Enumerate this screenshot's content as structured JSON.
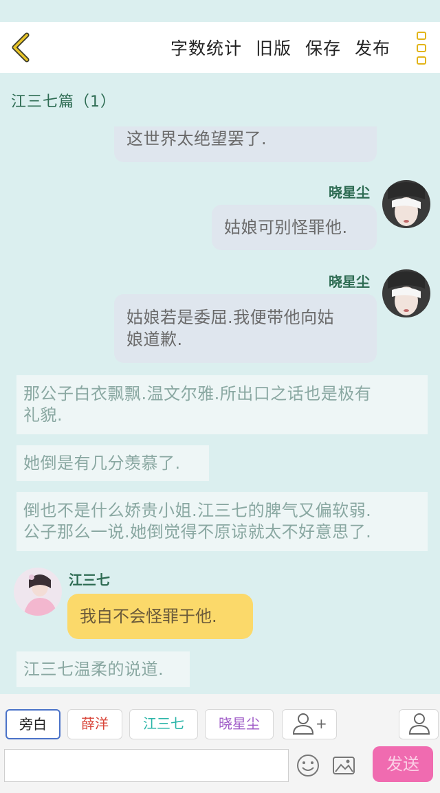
{
  "header": {
    "actions": [
      "字数统计",
      "旧版",
      "保存",
      "发布"
    ]
  },
  "chapter_title": "江三七篇（1）",
  "messages": {
    "partial_bubble": "这世界太绝望罢了.",
    "m1": {
      "speaker": "晓星尘",
      "text": "姑娘可别怪罪他."
    },
    "m2": {
      "speaker": "晓星尘",
      "text_line1": "姑娘若是委屈.我便带他向姑",
      "text_line2": "娘道歉."
    },
    "n1": {
      "line1": "那公子白衣飘飘.温文尔雅.所出口之话也是极有",
      "line2": "礼貌."
    },
    "n2": {
      "line1": "她倒是有几分羡慕了."
    },
    "n3": {
      "line1": "倒也不是什么娇贵小姐.江三七的脾气又偏软弱.",
      "line2": "公子那么一说.她倒觉得不原谅就太不好意思了."
    },
    "m3": {
      "speaker": "江三七",
      "text": "我自不会怪罪于他."
    },
    "n4": {
      "line1": "江三七温柔的说道."
    }
  },
  "roles": [
    {
      "label": "旁白",
      "color": "#222222"
    },
    {
      "label": "薛洋",
      "color": "#d9463a"
    },
    {
      "label": "江三七",
      "color": "#2bb5a8"
    },
    {
      "label": "晓星尘",
      "color": "#a05cc8"
    }
  ],
  "add_role_label": "+",
  "input": {
    "value": "",
    "placeholder": ""
  },
  "send_label": "发送",
  "icons": [
    "back-chevron-icon",
    "more-menu-icon",
    "add-person-icon",
    "person-icon",
    "emoji-icon",
    "image-icon"
  ],
  "colors": {
    "accent_yellow": "#e2b418",
    "send_pink": "#f06bb0",
    "name_green": "#2d6b52"
  }
}
